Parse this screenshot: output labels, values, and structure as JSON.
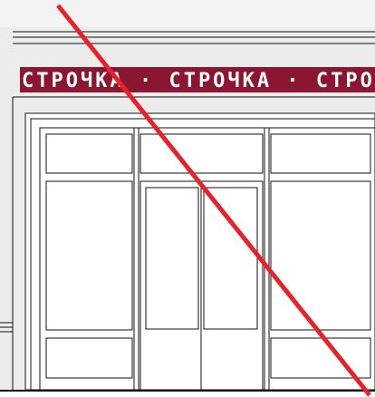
{
  "drawing": {
    "banner_text": "СТРОЧКА · СТРОЧКА · СТРОЧКА",
    "colors": {
      "background": "#efefef",
      "wall": "#e9e9e9",
      "banner": "#8b1632",
      "line": "#111111",
      "strike": "#e3242b"
    },
    "elements": [
      "facade-band",
      "shop-sign",
      "shopfront-frame",
      "transom-panels",
      "side-panels",
      "double-door",
      "kick-panels",
      "ground-line",
      "strike-through-line"
    ]
  }
}
